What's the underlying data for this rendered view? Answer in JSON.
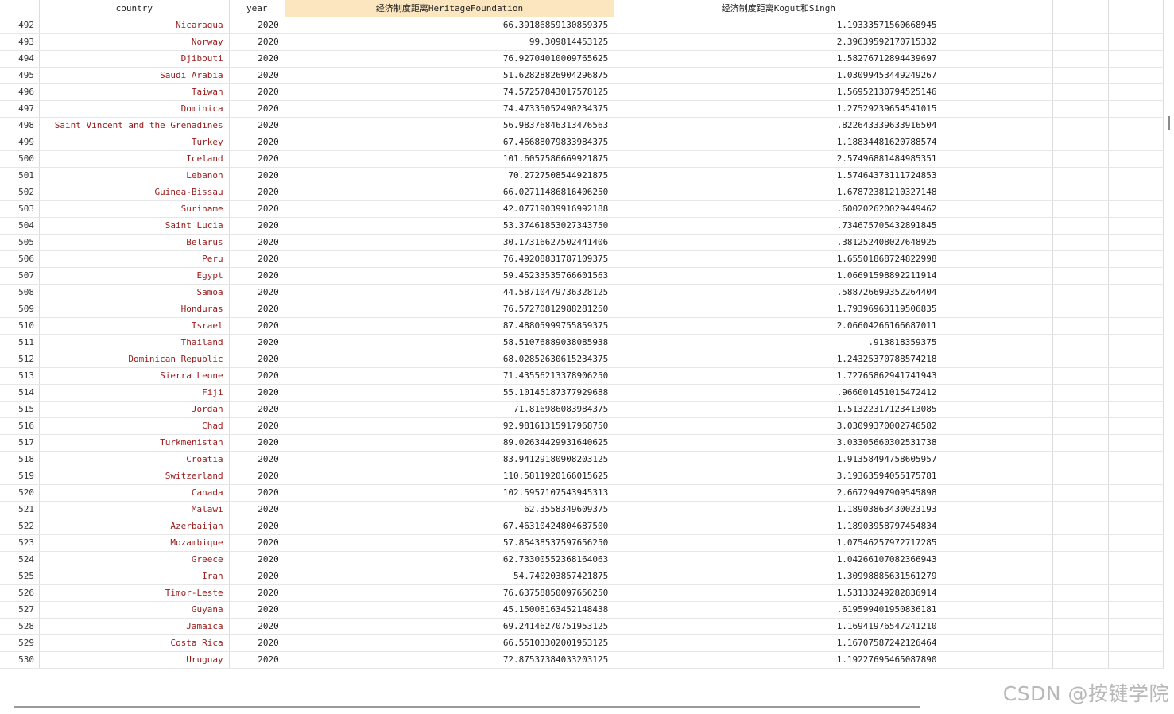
{
  "columns": [
    "country",
    "year",
    "经济制度距离HeritageFoundation",
    "经济制度距离Kogut和Singh"
  ],
  "rows": [
    [
      "492",
      "Nicaragua",
      "2020",
      "66.39186859130859375",
      "1.19333571560668945"
    ],
    [
      "493",
      "Norway",
      "2020",
      "99.309814453125",
      "2.39639592170715332"
    ],
    [
      "494",
      "Djibouti",
      "2020",
      "76.92704010009765625",
      "1.58276712894439697"
    ],
    [
      "495",
      "Saudi Arabia",
      "2020",
      "51.62828826904296875",
      "1.03099453449249267"
    ],
    [
      "496",
      "Taiwan",
      "2020",
      "74.57257843017578125",
      "1.56952130794525146"
    ],
    [
      "497",
      "Dominica",
      "2020",
      "74.47335052490234375",
      "1.27529239654541015"
    ],
    [
      "498",
      "Saint Vincent and the Grenadines",
      "2020",
      "56.98376846313476563",
      ".822643339633916504"
    ],
    [
      "499",
      "Turkey",
      "2020",
      "67.46688079833984375",
      "1.18834481620788574"
    ],
    [
      "500",
      "Iceland",
      "2020",
      "101.6057586669921875",
      "2.57496881484985351"
    ],
    [
      "501",
      "Lebanon",
      "2020",
      "70.2727508544921875",
      "1.57464373111724853"
    ],
    [
      "502",
      "Guinea-Bissau",
      "2020",
      "66.02711486816406250",
      "1.67872381210327148"
    ],
    [
      "503",
      "Suriname",
      "2020",
      "42.07719039916992188",
      ".600202620029449462"
    ],
    [
      "504",
      "Saint Lucia",
      "2020",
      "53.37461853027343750",
      ".734675705432891845"
    ],
    [
      "505",
      "Belarus",
      "2020",
      "30.17316627502441406",
      ".381252408027648925"
    ],
    [
      "506",
      "Peru",
      "2020",
      "76.49208831787109375",
      "1.65501868724822998"
    ],
    [
      "507",
      "Egypt",
      "2020",
      "59.45233535766601563",
      "1.06691598892211914"
    ],
    [
      "508",
      "Samoa",
      "2020",
      "44.58710479736328125",
      ".588726699352264404"
    ],
    [
      "509",
      "Honduras",
      "2020",
      "76.57270812988281250",
      "1.79396963119506835"
    ],
    [
      "510",
      "Israel",
      "2020",
      "87.48805999755859375",
      "2.06604266166687011"
    ],
    [
      "511",
      "Thailand",
      "2020",
      "58.51076889038085938",
      ".913818359375"
    ],
    [
      "512",
      "Dominican Republic",
      "2020",
      "68.02852630615234375",
      "1.24325370788574218"
    ],
    [
      "513",
      "Sierra Leone",
      "2020",
      "71.43556213378906250",
      "1.72765862941741943"
    ],
    [
      "514",
      "Fiji",
      "2020",
      "55.10145187377929688",
      ".966001451015472412"
    ],
    [
      "515",
      "Jordan",
      "2020",
      "71.816986083984375",
      "1.51322317123413085"
    ],
    [
      "516",
      "Chad",
      "2020",
      "92.98161315917968750",
      "3.03099370002746582"
    ],
    [
      "517",
      "Turkmenistan",
      "2020",
      "89.02634429931640625",
      "3.03305660302531738"
    ],
    [
      "518",
      "Croatia",
      "2020",
      "83.94129180908203125",
      "1.91358494758605957"
    ],
    [
      "519",
      "Switzerland",
      "2020",
      "110.5811920166015625",
      "3.19363594055175781"
    ],
    [
      "520",
      "Canada",
      "2020",
      "102.5957107543945313",
      "2.66729497909545898"
    ],
    [
      "521",
      "Malawi",
      "2020",
      "62.3558349609375",
      "1.18903863430023193"
    ],
    [
      "522",
      "Azerbaijan",
      "2020",
      "67.46310424804687500",
      "1.18903958797454834"
    ],
    [
      "523",
      "Mozambique",
      "2020",
      "57.85438537597656250",
      "1.07546257972717285"
    ],
    [
      "524",
      "Greece",
      "2020",
      "62.73300552368164063",
      "1.04266107082366943"
    ],
    [
      "525",
      "Iran",
      "2020",
      "54.740203857421875",
      "1.30998885631561279"
    ],
    [
      "526",
      "Timor-Leste",
      "2020",
      "76.63758850097656250",
      "1.53133249282836914"
    ],
    [
      "527",
      "Guyana",
      "2020",
      "45.15008163452148438",
      ".619599401950836181"
    ],
    [
      "528",
      "Jamaica",
      "2020",
      "69.24146270751953125",
      "1.16941976547241210"
    ],
    [
      "529",
      "Costa Rica",
      "2020",
      "66.55103302001953125",
      "1.16707587242126464"
    ],
    [
      "530",
      "Uruguay",
      "2020",
      "72.87537384033203125",
      "1.19227695465087890"
    ]
  ],
  "watermark": "CSDN @按键学院"
}
